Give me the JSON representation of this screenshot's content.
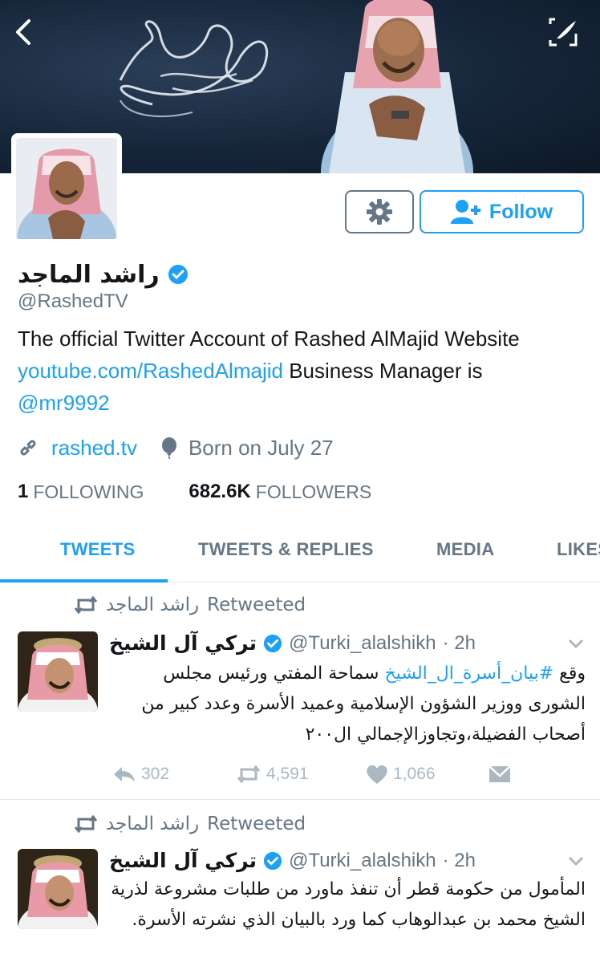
{
  "profile": {
    "name": "راشد الماجد",
    "handle": "@RashedTV",
    "bio_text_1": "The official Twitter Account of Rashed AlMajid Website",
    "bio_link": "youtube.com/RashedAlmajid",
    "bio_text_2": "Business Manager is",
    "bio_mention": "@mr9992",
    "website": "rashed.tv",
    "born": "Born on July 27",
    "following_count": "1",
    "following_label": "FOLLOWING",
    "followers_count": "682.6K",
    "followers_label": "FOLLOWERS"
  },
  "buttons": {
    "follow_label": "Follow"
  },
  "tabs": [
    {
      "label": "TWEETS",
      "active": true
    },
    {
      "label": "TWEETS & REPLIES",
      "active": false
    },
    {
      "label": "MEDIA",
      "active": false
    },
    {
      "label": "LIKES",
      "active": false
    }
  ],
  "tweets": [
    {
      "retweeter": "راشد الماجد",
      "retweeted_label": "Retweeted",
      "author": "تركي آل الشيخ",
      "handle": "@Turki_alalshikh",
      "time": "· 2h",
      "text_prefix": "وقع ",
      "hashtag": "#بيان_أسرة_ال_الشيخ",
      "text_rest": " سماحة المفتي ورئيس مجلس الشورى ووزير الشؤون الإسلامية وعميد الأسرة وعدد كبير من أصحاب الفضيلة،وتجاوزالإجمالي ال٢٠٠",
      "replies": "302",
      "retweets": "4,591",
      "likes": "1,066"
    },
    {
      "retweeter": "راشد الماجد",
      "retweeted_label": "Retweeted",
      "author": "تركي آل الشيخ",
      "handle": "@Turki_alalshikh",
      "time": "· 2h",
      "text": "المأمول من حكومة قطر أن تنفذ ماورد من طلبات مشروعة لذرية الشيخ محمد بن عبدالوهاب كما ورد بالبيان الذي نشرته الأسرة."
    }
  ],
  "colors": {
    "accent": "#1da1f2",
    "secondary_text": "#657786",
    "icon_gray": "#aab8c2",
    "divider": "#e1e8ed"
  },
  "icons": [
    "back-arrow-icon",
    "edit-icon",
    "gear-icon",
    "add-user-icon",
    "verified-icon",
    "link-icon",
    "balloon-icon",
    "retweet-icon",
    "chevron-down-icon",
    "reply-icon",
    "heart-icon",
    "direct-message-icon"
  ]
}
